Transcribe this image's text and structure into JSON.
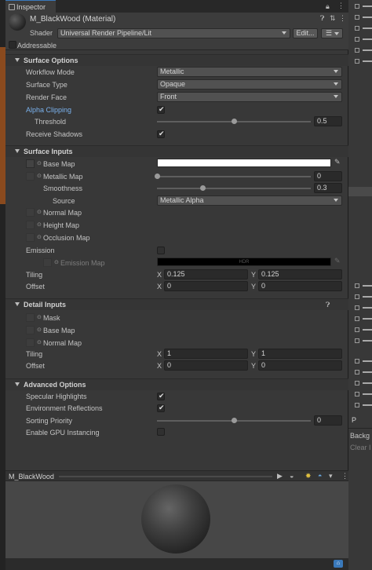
{
  "window": {
    "tab_label": "Inspector"
  },
  "header": {
    "material_title": "M_BlackWood (Material)",
    "shader_label": "Shader",
    "shader_value": "Universal Render Pipeline/Lit",
    "edit_button": "Edit...",
    "addressable_label": "Addressable"
  },
  "surface_options": {
    "title": "Surface Options",
    "rows": [
      {
        "label": "Workflow Mode",
        "value": "Metallic"
      },
      {
        "label": "Surface Type",
        "value": "Opaque"
      },
      {
        "label": "Render Face",
        "value": "Front"
      }
    ],
    "alpha_clipping_label": "Alpha Clipping",
    "alpha_clipping_checked": true,
    "threshold_label": "Threshold",
    "threshold_value": "0.5",
    "threshold_fraction": 0.5,
    "receive_shadows_label": "Receive Shadows",
    "receive_shadows_checked": true
  },
  "surface_inputs": {
    "title": "Surface Inputs",
    "base_map_label": "Base Map",
    "base_map_color": "#ffffff",
    "metallic_map_label": "Metallic Map",
    "metallic_value": "0",
    "metallic_fraction": 0,
    "smoothness_label": "Smoothness",
    "smoothness_value": "0.3",
    "smoothness_fraction": 0.3,
    "source_label": "Source",
    "source_value": "Metallic Alpha",
    "normal_map_label": "Normal Map",
    "height_map_label": "Height Map",
    "occlusion_map_label": "Occlusion Map",
    "emission_label": "Emission",
    "emission_map_label": "Emission Map",
    "emission_hdr_label": "HDR",
    "tiling_label": "Tiling",
    "tiling_x": "0.125",
    "tiling_y": "0.125",
    "offset_label": "Offset",
    "offset_x": "0",
    "offset_y": "0",
    "x_label": "X",
    "y_label": "Y"
  },
  "detail_inputs": {
    "title": "Detail Inputs",
    "mask_label": "Mask",
    "base_map_label": "Base Map",
    "normal_map_label": "Normal Map",
    "tiling_label": "Tiling",
    "tiling_x": "1",
    "tiling_y": "1",
    "offset_label": "Offset",
    "offset_x": "0",
    "offset_y": "0",
    "x_label": "X",
    "y_label": "Y"
  },
  "advanced_options": {
    "title": "Advanced Options",
    "specular_highlights_label": "Specular Highlights",
    "specular_highlights_checked": true,
    "environment_reflections_label": "Environment Reflections",
    "environment_reflections_checked": true,
    "sorting_priority_label": "Sorting Priority",
    "sorting_priority_value": "0",
    "sorting_priority_fraction": 0.5,
    "gpu_instancing_label": "Enable GPU Instancing",
    "gpu_instancing_checked": false
  },
  "preview": {
    "title": "M_BlackWood"
  },
  "right_panel": {
    "background_label": "Backg",
    "clear_label": "Clear I",
    "item_label": "P"
  },
  "colors": {
    "panel_bg": "#383838",
    "accent_blue": "#7ab1ec",
    "tab_accent": "#3a79bb"
  }
}
